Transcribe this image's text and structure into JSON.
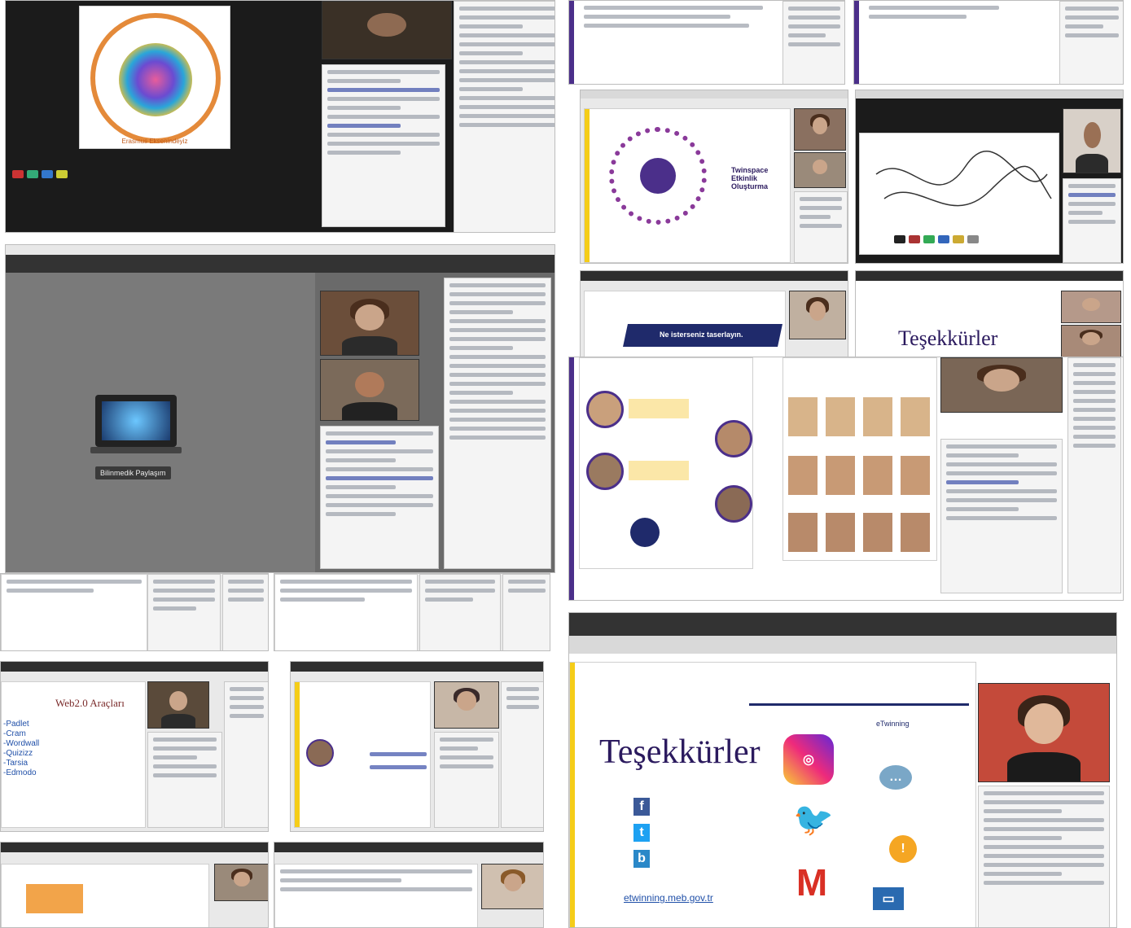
{
  "collage": {
    "tile_top_left": {
      "logo_text": "Erasmus Eksenindeyiz"
    },
    "tile_middle_left": {
      "button_label": "Bilinmedik Paylaşım"
    },
    "tile_right_1": {
      "slide_title": "Twinspace Etkinlik Oluşturma"
    },
    "tile_right_2": {
      "banner_text": "Ne isterseniz taserlayın."
    },
    "tile_right_3": {
      "title": "Teşekkürler"
    },
    "tile_bottom_left_1": {
      "title": "Web2.0 Araçları",
      "items": [
        "-Padlet",
        "-Cram",
        "-Wordwall",
        "-Quizizz",
        "-Tarsia",
        "-Edmodo"
      ]
    },
    "tile_bottom_right": {
      "title": "Teşekkürler",
      "link": "etwinning.meb.gov.tr",
      "brand": "eTwinning"
    }
  },
  "colors": {
    "accent_yellow": "#f5cd18",
    "accent_purple": "#4b2f8a",
    "instagram": "#d6249f",
    "twitter": "#1da1f2",
    "gmail": "#d93025",
    "facebook": "#3b5998"
  }
}
